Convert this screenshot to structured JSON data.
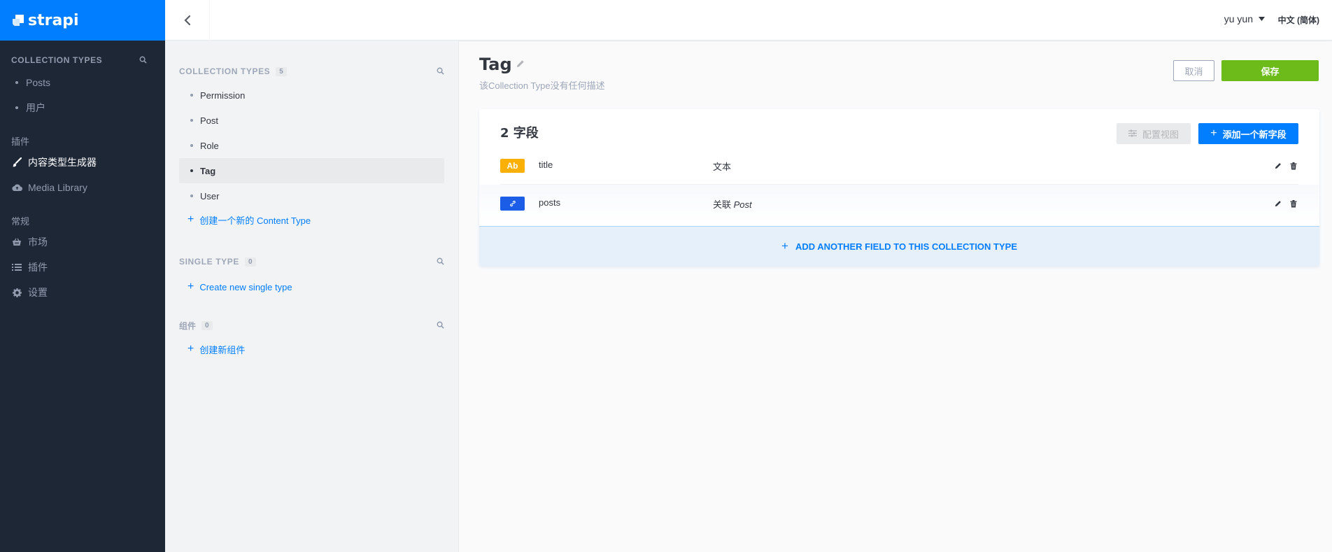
{
  "brand": {
    "name": "strapi"
  },
  "left_sidebar": {
    "collection_types_label": "COLLECTION TYPES",
    "collection_items": [
      {
        "label": "Posts"
      },
      {
        "label": "用户"
      }
    ],
    "plugins_title": "插件",
    "plugins": [
      {
        "label": "内容类型生成器",
        "icon": "paintbrush-icon",
        "active": true
      },
      {
        "label": "Media Library",
        "icon": "cloud-upload-icon",
        "active": false
      }
    ],
    "general_title": "常规",
    "general": [
      {
        "label": "市场",
        "icon": "shopping-basket-icon"
      },
      {
        "label": "插件",
        "icon": "list-icon"
      },
      {
        "label": "设置",
        "icon": "gear-icon"
      }
    ]
  },
  "header": {
    "user": "yu yun",
    "language": "中文 (简体)"
  },
  "middle": {
    "collection_types": {
      "label": "COLLECTION TYPES",
      "count": "5",
      "items": [
        {
          "label": "Permission"
        },
        {
          "label": "Post"
        },
        {
          "label": "Role"
        },
        {
          "label": "Tag",
          "active": true
        },
        {
          "label": "User"
        }
      ],
      "create_label": "创建一个新的 Content Type"
    },
    "single_type": {
      "label": "SINGLE TYPE",
      "count": "0",
      "create_label": "Create new single type"
    },
    "components": {
      "label": "组件",
      "count": "0",
      "create_label": "创建新组件"
    }
  },
  "main": {
    "title": "Tag",
    "description": "该Collection Type没有任何描述",
    "cancel_label": "取消",
    "save_label": "保存",
    "fields_count_label": "2 字段",
    "configure_view_label": "配置视图",
    "add_field_label": "添加一个新字段",
    "fields": [
      {
        "badge": "Ab",
        "name": "title",
        "type": "文本",
        "type_target": ""
      },
      {
        "badge": "",
        "name": "posts",
        "type": "关联",
        "type_target": "Post"
      }
    ],
    "add_another_label": "ADD ANOTHER FIELD TO THIS COLLECTION TYPE"
  },
  "colors": {
    "brand_blue": "#007eff",
    "sidebar_dark": "#1e2736",
    "save_green": "#6dbb1a",
    "text_badge": "#fab005",
    "relation_badge": "#1c5de7"
  }
}
